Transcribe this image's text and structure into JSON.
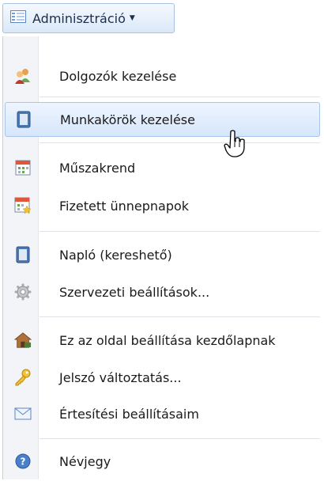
{
  "menu_button": {
    "label": "Adminisztráció",
    "icon": "form-list-icon",
    "caret_icon": "caret-down-icon"
  },
  "menu_items": [
    {
      "label": "Dolgozók kezelése",
      "icon": "users-icon"
    },
    {
      "label": "Munkakörök kezelése",
      "icon": "book-icon",
      "active": true
    },
    {
      "label": "Műszakrend",
      "icon": "calendar-icon"
    },
    {
      "label": "Fizetett ünnepnapok",
      "icon": "calendar-star-icon"
    },
    {
      "label": "Napló (kereshető)",
      "icon": "book-icon"
    },
    {
      "label": "Szervezeti beállítások...",
      "icon": "gear-icon"
    },
    {
      "label": "Ez az oldal beállítása kezdőlapnak",
      "icon": "home-icon"
    },
    {
      "label": "Jelszó változtatás...",
      "icon": "key-icon"
    },
    {
      "label": "Értesítési beállításaim",
      "icon": "envelope-icon"
    },
    {
      "label": "Névjegy",
      "icon": "help-icon"
    }
  ],
  "cursor_icon": "hand-pointer-icon"
}
